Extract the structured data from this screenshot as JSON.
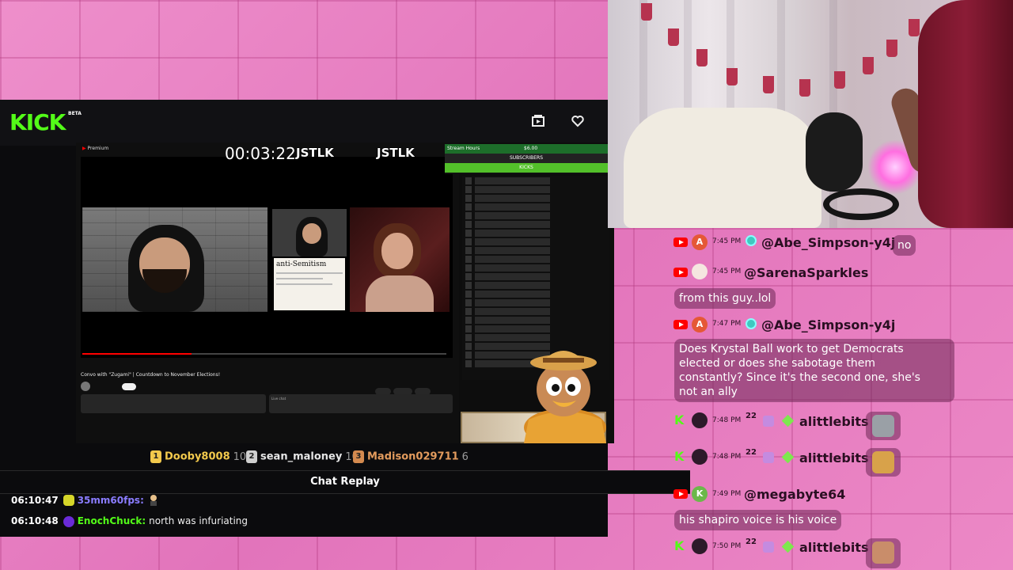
{
  "player": {
    "logo": "KICK",
    "logo_tag": "BETA",
    "stream": {
      "timer": "00:03:22",
      "badge1": "JSTLK",
      "badge2": "JSTLK",
      "goal_label": "Stream Hours",
      "goal_value": "$6.00",
      "subs_label": "SUBSCRIBERS",
      "kicks_label": "KICKS",
      "yt_premium": "Premium",
      "note_title": "anti-Semitism",
      "yt_video_title": "Convo with \"Zugami\" | Countdown to November Elections!",
      "live_chat_label": "Live chat"
    },
    "leaderboard": [
      {
        "rank": "1",
        "name": "Dooby8008",
        "count": "10",
        "color": "#f2c94c",
        "badge_color": "#f2c94c"
      },
      {
        "rank": "2",
        "name": "sean_maloney",
        "count": "10",
        "color": "#e6e6e6",
        "badge_color": "#cfcfcf"
      },
      {
        "rank": "3",
        "name": "Madison029711",
        "count": "6",
        "color": "#e39b5d",
        "badge_color": "#d48a4f"
      }
    ],
    "chat_replay": {
      "title": "Chat Replay",
      "messages": [
        {
          "time": "06:10:47",
          "user": "35mm60fps:",
          "user_color": "#8a7cff",
          "badge_color": "#d6d629",
          "text": ""
        },
        {
          "time": "06:10:48",
          "user": "EnochChuck:",
          "user_color": "#53fc18",
          "badge_color": "#6a2bd8",
          "text": "north was infuriating"
        }
      ]
    }
  },
  "chat_overlay": {
    "messages": [
      {
        "source": "youtube",
        "avatar": "A",
        "avatar_color": "#e55836",
        "time": "7:45 PM",
        "user": "@Abe_Simpson-y4j",
        "text": "no"
      },
      {
        "source": "youtube",
        "avatar": "",
        "avatar_color": "#f5e6e0",
        "time": "7:45 PM",
        "user": "@SarenaSparkles",
        "text": "from this guy..lol"
      },
      {
        "source": "youtube",
        "avatar": "A",
        "avatar_color": "#e55836",
        "time": "7:47 PM",
        "user": "@Abe_Simpson-y4j",
        "text_lines": [
          "Does Krystal Ball work to get Democrats",
          "elected or does she sabotage them",
          "constantly? Since it's the second one, she's",
          "not an ally"
        ]
      },
      {
        "source": "kick",
        "avatar": "",
        "avatar_color": "#2d1a2a",
        "time": "7:48 PM",
        "sub": "22",
        "user": "alittlebits",
        "text": ""
      },
      {
        "source": "kick",
        "avatar": "",
        "avatar_color": "#2d1a2a",
        "time": "7:48 PM",
        "sub": "22",
        "user": "alittlebits",
        "text": ""
      },
      {
        "source": "youtube",
        "avatar": "K",
        "avatar_color": "#6bb84a",
        "time": "7:49 PM",
        "user": "@megabyte64",
        "text": "his shapiro voice is his voice"
      },
      {
        "source": "kick",
        "avatar": "",
        "avatar_color": "#2d1a2a",
        "time": "7:50 PM",
        "sub": "22",
        "user": "alittlebits",
        "text": ""
      }
    ]
  },
  "colors": {
    "kick_green": "#53fc18",
    "youtube_red": "#ff0000",
    "bubble": "#6e2855"
  }
}
